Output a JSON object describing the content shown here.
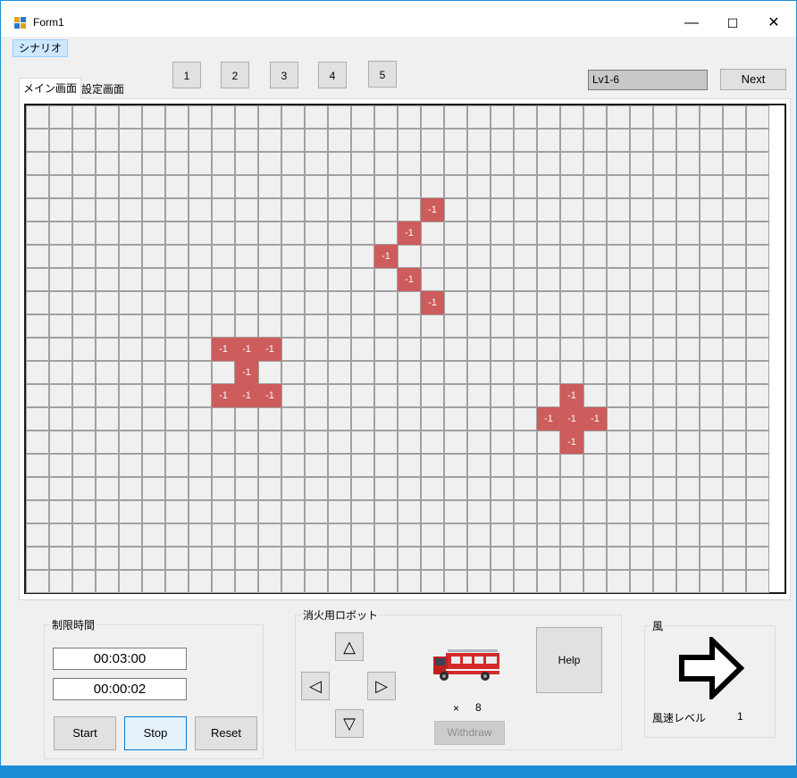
{
  "window": {
    "title": "Form1",
    "minimize": "—",
    "maximize": "☐",
    "close": "✕"
  },
  "menu": {
    "scenario": "シナリオ"
  },
  "toolbar": {
    "numbers": [
      "1",
      "2",
      "3",
      "4",
      "5"
    ],
    "level": "Lv1-6",
    "next": "Next"
  },
  "tabs": {
    "main": "メイン画面",
    "settings": "設定画面"
  },
  "grid": {
    "cols": 32,
    "rows": 21,
    "fire_value": "-1",
    "fires": [
      [
        17,
        4
      ],
      [
        16,
        5
      ],
      [
        15,
        6
      ],
      [
        16,
        7
      ],
      [
        17,
        8
      ],
      [
        8,
        10
      ],
      [
        9,
        10
      ],
      [
        10,
        10
      ],
      [
        9,
        11
      ],
      [
        8,
        12
      ],
      [
        9,
        12
      ],
      [
        10,
        12
      ],
      [
        23,
        12
      ],
      [
        22,
        13
      ],
      [
        23,
        13
      ],
      [
        24,
        13
      ],
      [
        23,
        14
      ]
    ]
  },
  "time_limit": {
    "title": "制限時間",
    "limit": "00:03:00",
    "elapsed": "00:00:02",
    "start": "Start",
    "stop": "Stop",
    "reset": "Reset"
  },
  "robot": {
    "title": "消火用ロボット",
    "up": "△",
    "left": "◁",
    "right": "▷",
    "down": "▽",
    "count_x": "×",
    "count": "8",
    "withdraw": "Withdraw",
    "help": "Help"
  },
  "wind": {
    "title": "風",
    "speed_label": "風速レベル",
    "speed": "1"
  },
  "colors": {
    "fire": "#cd5c5c",
    "accent": "#0078d7"
  }
}
